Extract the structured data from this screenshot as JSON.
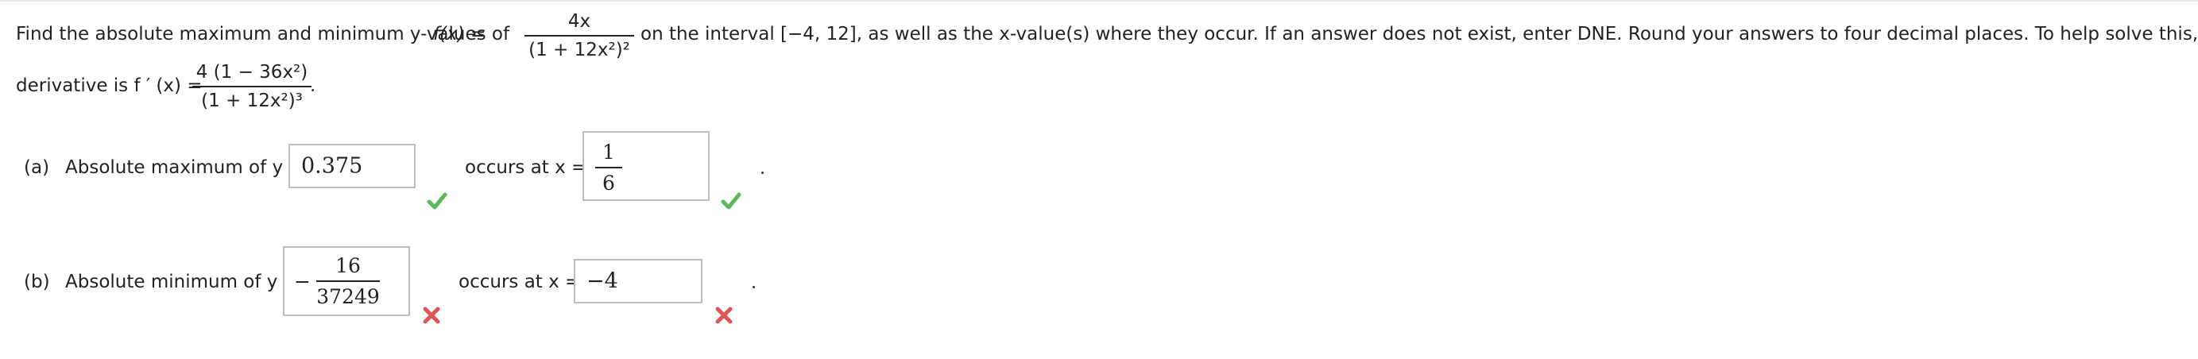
{
  "question": {
    "intro_before": "Find the absolute maximum and minimum y-values of",
    "f_of_x": "f(x) =",
    "f_num": "4x",
    "f_den": "(1 + 12x²)²",
    "intro_after": "on the interval [−4, 12], as well as the x-value(s) where they occur. If an answer does not exist, enter DNE. Round your answers to four decimal places. To help solve this, the first",
    "deriv_label": "derivative is f ′ (x) =",
    "deriv_num": "4 (1 − 36x²)",
    "deriv_den": "(1 + 12x²)³",
    "deriv_end": "."
  },
  "part_a": {
    "label": "(a)",
    "prompt": "Absolute maximum of y =",
    "answer_value": "0.375",
    "answer_status": "correct",
    "occurs_label": "occurs at x =",
    "occurs_num": "1",
    "occurs_den": "6",
    "occurs_status": "correct",
    "end": "."
  },
  "part_b": {
    "label": "(b)",
    "prompt": "Absolute minimum of y =",
    "answer_sign": "−",
    "answer_num": "16",
    "answer_den": "37249",
    "answer_status": "incorrect",
    "occurs_label": "occurs at x =",
    "occurs_value": "−4",
    "occurs_status": "incorrect",
    "end": "."
  },
  "colors": {
    "correct": "#5cb85c",
    "incorrect": "#e05555",
    "box_border": "#bdbdbd"
  }
}
